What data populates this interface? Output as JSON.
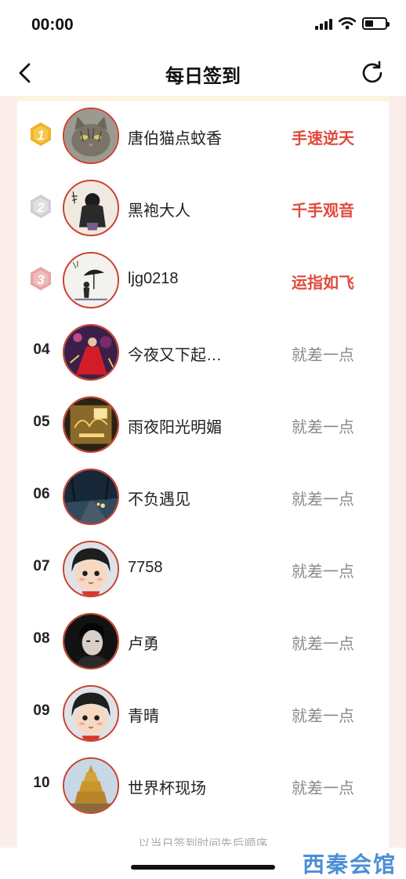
{
  "status_bar": {
    "time": "00:00"
  },
  "nav": {
    "title": "每日签到"
  },
  "ranking": [
    {
      "rank": "1",
      "medal": "gold",
      "name": "唐伯猫点蚊香",
      "tag": "手速逆天",
      "tag_type": "hot",
      "avatar": "cat-photo"
    },
    {
      "rank": "2",
      "medal": "silver",
      "name": "黑袍大人",
      "tag": "千手观音",
      "tag_type": "hot",
      "avatar": "ink-figure"
    },
    {
      "rank": "3",
      "medal": "bronze",
      "name": "ljg0218",
      "tag": "运指如飞",
      "tag_type": "hot",
      "avatar": "umbrella-sketch"
    },
    {
      "rank": "04",
      "name": "今夜又下起…",
      "tag": "就差一点",
      "tag_type": "normal",
      "avatar": "red-dress"
    },
    {
      "rank": "05",
      "name": "雨夜阳光明媚",
      "tag": "就差一点",
      "tag_type": "normal",
      "avatar": "gold-poster"
    },
    {
      "rank": "06",
      "name": "不负遇见",
      "tag": "就差一点",
      "tag_type": "normal",
      "avatar": "night-road"
    },
    {
      "rank": "07",
      "name": "7758",
      "tag": "就差一点",
      "tag_type": "normal",
      "avatar": "cartoon-kid"
    },
    {
      "rank": "08",
      "name": "卢勇",
      "tag": "就差一点",
      "tag_type": "normal",
      "avatar": "man-portrait"
    },
    {
      "rank": "09",
      "name": "青晴",
      "tag": "就差一点",
      "tag_type": "normal",
      "avatar": "cartoon-kid"
    },
    {
      "rank": "10",
      "name": "世界杯现场",
      "tag": "就差一点",
      "tag_type": "normal",
      "avatar": "golden-pagoda"
    }
  ],
  "footer": {
    "note": "以当日签到时间先后顺序"
  },
  "watermark": {
    "text": "西秦会馆"
  },
  "colors": {
    "accent": "#e04a3c",
    "avatar_border": "#c8402f",
    "muted": "#8a8a8a",
    "gold": "#f0b429",
    "silver": "#cfcfcf",
    "bronze": "#e7a5a5"
  }
}
